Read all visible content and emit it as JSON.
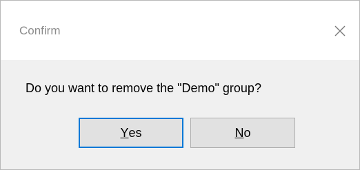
{
  "dialog": {
    "title": "Confirm",
    "message": "Do you want to remove the \"Demo\" group?",
    "close_icon": "close-icon"
  },
  "buttons": {
    "yes": {
      "mnemonic": "Y",
      "rest": "es"
    },
    "no": {
      "mnemonic": "N",
      "rest": "o"
    }
  },
  "colors": {
    "default_button_border": "#0078d7",
    "button_face": "#e1e1e1",
    "title_text": "#8c8c8c"
  }
}
